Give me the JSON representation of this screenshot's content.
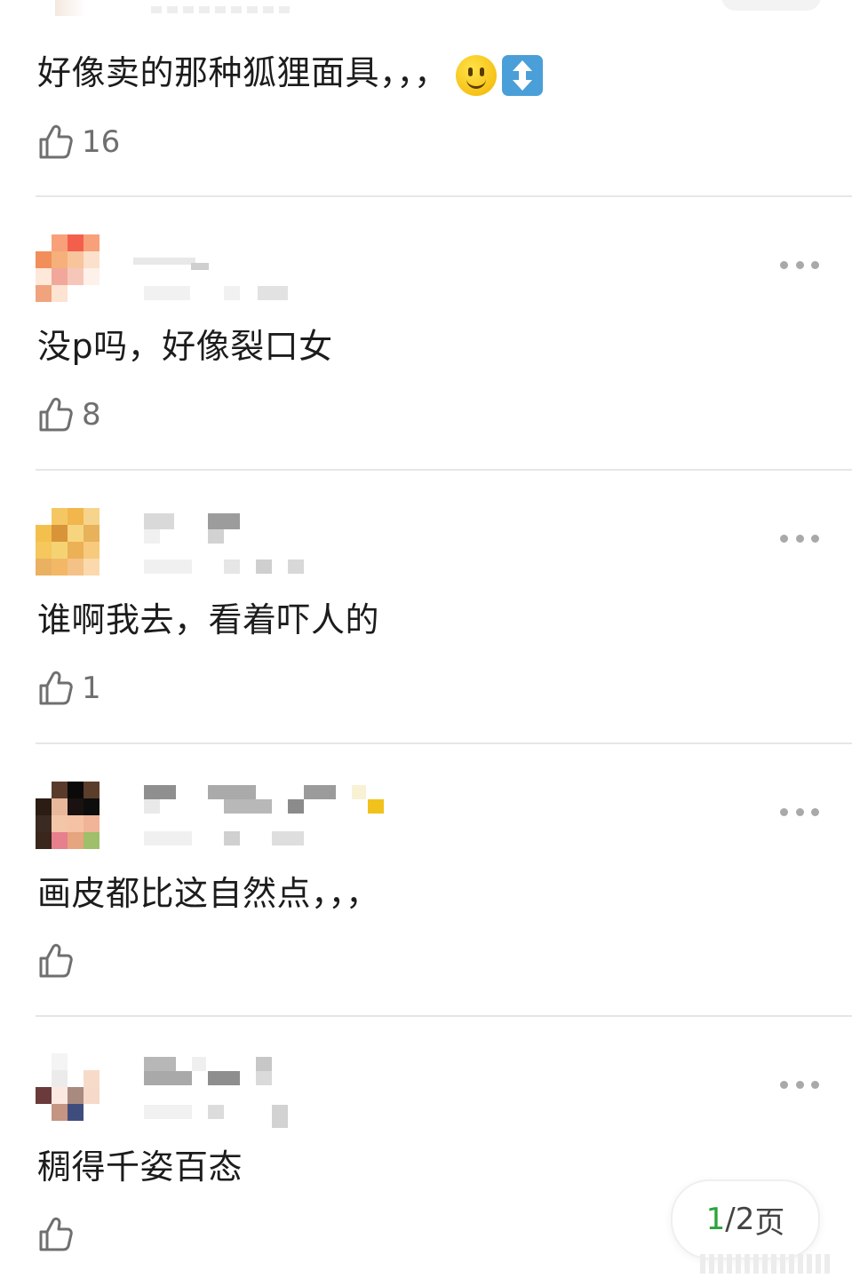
{
  "comments": [
    {
      "text": "好像卖的那种狐狸面具，，，",
      "emoji": [
        "smiley-emoji",
        "up-down-arrow-emoji"
      ],
      "likes": "16"
    },
    {
      "text": "没p吗，好像裂口女",
      "likes": "8"
    },
    {
      "text": "谁啊我去，看着吓人的",
      "likes": "1"
    },
    {
      "text": "画皮都比这自然点，，，",
      "likes": ""
    },
    {
      "text": "稠得千姿百态",
      "likes": ""
    }
  ],
  "pager": {
    "current": "1",
    "sep": "/",
    "total": "2",
    "unit": "页"
  },
  "icons": {
    "like": "thumbs-up-icon",
    "more": "more-dots-icon"
  },
  "colors": {
    "accent": "#2aa53a",
    "text": "#1c1c1c",
    "muted": "#6f6f6f",
    "divider": "#e6e6e6",
    "dots": "#a9a9a9"
  }
}
